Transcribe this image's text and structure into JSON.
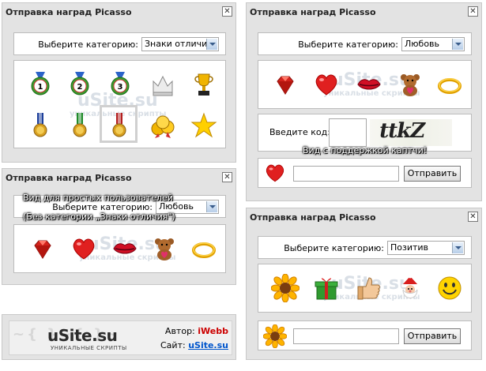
{
  "panel_title": "Отправка наград Picasso",
  "close_symbol": "✕",
  "category_label": "Выберите категорию:",
  "code_label": "Введите код:",
  "send_button": "Отправить",
  "captcha_text": "ttkZ",
  "watermark_main": "uSite.su",
  "watermark_sub": "уникальные скрипты",
  "panel1": {
    "selected_category": "Знаки отличия",
    "icons": [
      "medal-1-icon",
      "medal-2-icon",
      "medal-3-icon",
      "crown-icon",
      "trophy-icon",
      "bronze-medal-icon",
      "green-medal-icon",
      "red-medal-icon",
      "coins-icon",
      "star-icon"
    ]
  },
  "panel2": {
    "selected_category": "Любовь",
    "tip_line1": "Вид для простых пользователей",
    "tip_line2": "(Без категории „Знаки отличия\")",
    "icons": [
      "ruby-icon",
      "heart-icon",
      "lips-icon",
      "teddy-bear-icon",
      "ring-icon"
    ]
  },
  "panel3": {
    "selected_category": "Любовь",
    "captcha_tip": "Вид с поддержкой каптчи!",
    "icons": [
      "ruby-icon",
      "heart-icon",
      "lips-icon",
      "teddy-bear-icon",
      "ring-icon"
    ],
    "selected_icon": "heart-icon"
  },
  "panel4": {
    "selected_category": "Позитив",
    "icons": [
      "sunflower-icon",
      "gift-icon",
      "thumbs-up-icon",
      "santa-icon",
      "smiley-icon"
    ],
    "selected_icon": "sunflower-icon"
  },
  "footer": {
    "logo": "uSite.su",
    "logo_sub": "УНИКАЛЬНЫЕ СКРИПТЫ",
    "author_label": "Автор:",
    "author_name": "iWebb",
    "site_label": "Сайт:",
    "site_link": "uSite.su"
  },
  "colors": {
    "author": "#cc0000",
    "link": "#0055cc",
    "panel_bg": "#e3e3e3"
  }
}
